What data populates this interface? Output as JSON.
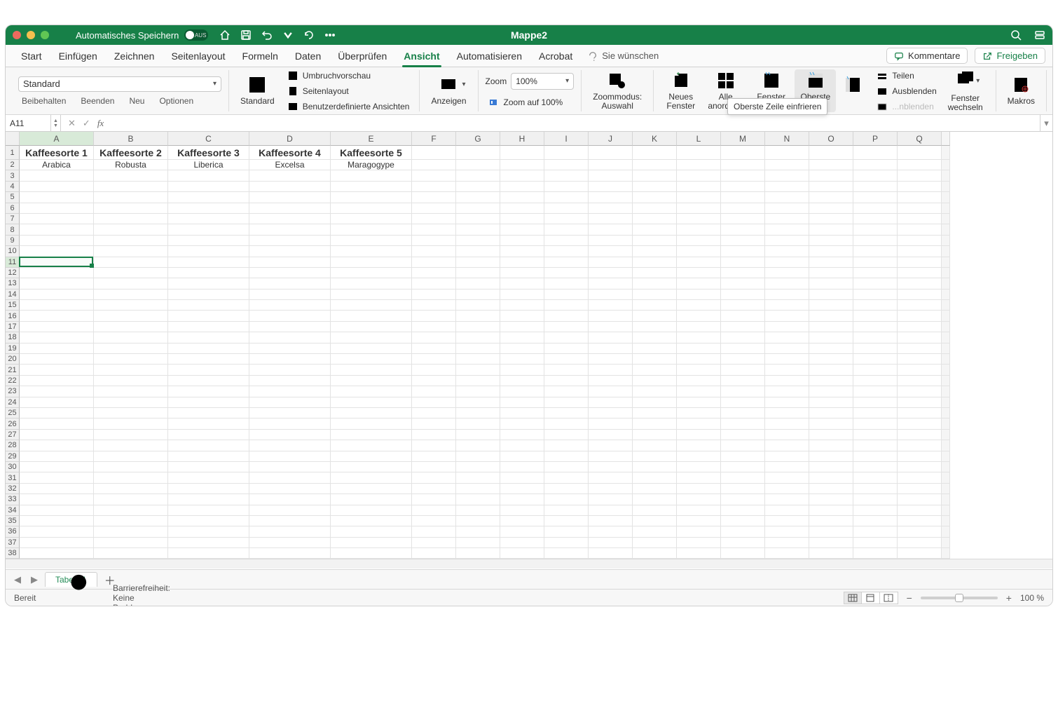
{
  "titlebar": {
    "autosave_label": "Automatisches Speichern",
    "autosave_state": "AUS",
    "document_title": "Mappe2"
  },
  "tabs": {
    "items": [
      "Start",
      "Einfügen",
      "Zeichnen",
      "Seitenlayout",
      "Formeln",
      "Daten",
      "Überprüfen",
      "Ansicht",
      "Automatisieren",
      "Acrobat"
    ],
    "active_index": 7,
    "wish": "Sie wünschen",
    "comments": "Kommentare",
    "share": "Freigeben"
  },
  "toolrow": {
    "style_value": "Standard",
    "keep": "Beibehalten",
    "exit": "Beenden",
    "new": "Neu",
    "options": "Optionen"
  },
  "ribbon": {
    "standard": "Standard",
    "umbruch": "Umbruchvorschau",
    "seitenlayout": "Seitenlayout",
    "benutzer": "Benutzerdefinierte Ansichten",
    "anzeigen": "Anzeigen",
    "zoom_label": "Zoom",
    "zoom_value": "100%",
    "zoom100": "Zoom auf 100%",
    "zoommodus": "Zoommodus: Auswahl",
    "neues_fenster": "Neues Fenster",
    "alle_anordnen": "Alle anordnen",
    "fenster_fixieren": "Fenster fixieren",
    "oberste": "Oberste einfri...",
    "teilen": "Teilen",
    "ausblenden": "Ausblenden",
    "einblenden": "...nblenden",
    "fenster_wechseln": "Fenster wechseln",
    "makros": "Makros",
    "tooltip": "Oberste Zeile einfrieren"
  },
  "formula_bar": {
    "cell_ref": "A11",
    "formula": ""
  },
  "columns": [
    "A",
    "B",
    "C",
    "D",
    "E",
    "F",
    "G",
    "H",
    "I",
    "J",
    "K",
    "L",
    "M",
    "N",
    "O",
    "P",
    "Q"
  ],
  "col_widths_data": [
    106,
    106,
    116,
    116,
    116
  ],
  "default_col_w": 63,
  "row_count": 38,
  "header_row_h": 20,
  "default_row_h": 15.4,
  "bold_row_h": 20,
  "selected_cell": {
    "row": 11,
    "col": 0
  },
  "data_rows": [
    {
      "bold": true,
      "cells": [
        "Kaffeesorte 1",
        "Kaffeesorte 2",
        "Kaffeesorte 3",
        "Kaffeesorte 4",
        "Kaffeesorte 5"
      ]
    },
    {
      "bold": false,
      "cells": [
        "Arabica",
        "Robusta",
        "Liberica",
        "Excelsa",
        "Maragogype"
      ]
    }
  ],
  "sheet": {
    "tab_name": "Tabelle1"
  },
  "status": {
    "ready": "Bereit",
    "accessibility": "Barrierefreiheit: Keine Probleme",
    "zoom": "100 %"
  }
}
